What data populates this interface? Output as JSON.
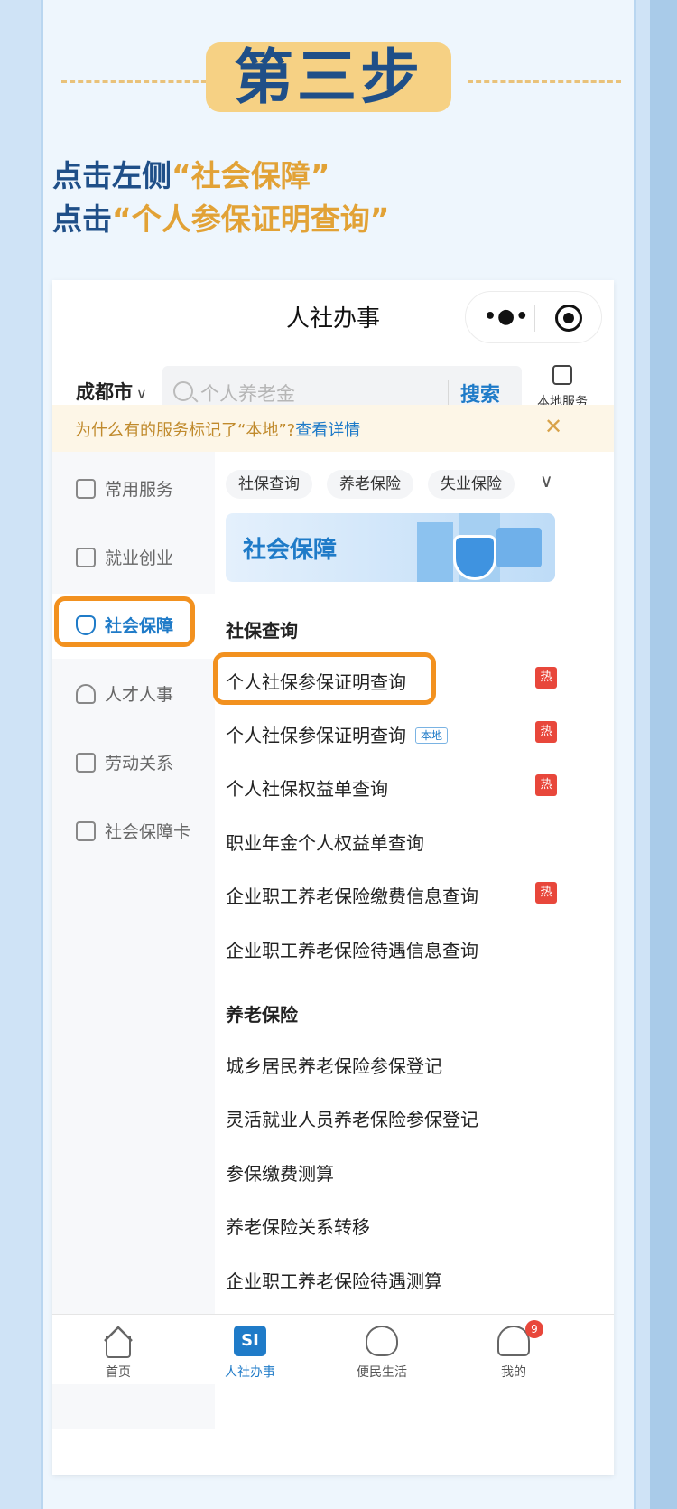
{
  "step": {
    "label": "第三步"
  },
  "instructions": [
    {
      "prefix": "点击左侧",
      "open": "“",
      "highlight": "社会保障",
      "close": "”"
    },
    {
      "prefix": "点击",
      "open": "“",
      "highlight": "个人参保证明查询",
      "close": "”"
    }
  ],
  "app": {
    "title": "人社办事",
    "capsule_more": "•●•",
    "city": "成都市",
    "city_chevron": "∨",
    "search": {
      "placeholder": "个人养老金",
      "button": "搜索"
    },
    "local_service": "本地服务",
    "tip": {
      "text": "为什么有的服务标记了“本地”?",
      "link": "查看详情",
      "close": "✕"
    },
    "sidebar": [
      {
        "label": "常用服务",
        "icon": "grid-icon"
      },
      {
        "label": "就业创业",
        "icon": "briefcase-icon"
      },
      {
        "label": "社会保障",
        "icon": "shield-icon",
        "active": true
      },
      {
        "label": "人才人事",
        "icon": "person-icon"
      },
      {
        "label": "劳动关系",
        "icon": "badge-icon"
      },
      {
        "label": "社会保障卡",
        "icon": "id-card-icon"
      }
    ],
    "chips": [
      "社保查询",
      "养老保险",
      "失业保险"
    ],
    "chip_more": "∨",
    "banner": {
      "title": "社会保障"
    },
    "sections": [
      {
        "title": "社保查询",
        "items": [
          {
            "label": "个人社保参保证明查询",
            "tag": "",
            "hot": "热"
          },
          {
            "label": "个人社保参保证明查询",
            "tag": "本地",
            "hot": "热"
          },
          {
            "label": "个人社保权益单查询",
            "tag": "",
            "hot": "热"
          },
          {
            "label": "职业年金个人权益单查询",
            "tag": "",
            "hot": ""
          },
          {
            "label": "企业职工养老保险缴费信息查询",
            "tag": "",
            "hot": "热"
          },
          {
            "label": "企业职工养老保险待遇信息查询",
            "tag": "",
            "hot": ""
          }
        ]
      },
      {
        "title": "养老保险",
        "items": [
          {
            "label": "城乡居民养老保险参保登记"
          },
          {
            "label": "灵活就业人员养老保险参保登记"
          },
          {
            "label": "参保缴费测算"
          },
          {
            "label": "养老保险关系转移"
          },
          {
            "label": "企业职工养老保险待遇测算"
          }
        ]
      }
    ],
    "tabbar": [
      {
        "label": "首页",
        "icon": "home-icon"
      },
      {
        "label": "人社办事",
        "icon": "si-icon",
        "icon_text": "SI",
        "active": true
      },
      {
        "label": "便民生活",
        "icon": "handshake-icon"
      },
      {
        "label": "我的",
        "icon": "user-icon",
        "badge": "9"
      }
    ]
  },
  "colors": {
    "accent_blue": "#1f7bc8",
    "highlight_orange": "#f2911f",
    "title_navy": "#1f4f88",
    "quote_gold": "#e2a236",
    "hot_red": "#e8473b"
  }
}
